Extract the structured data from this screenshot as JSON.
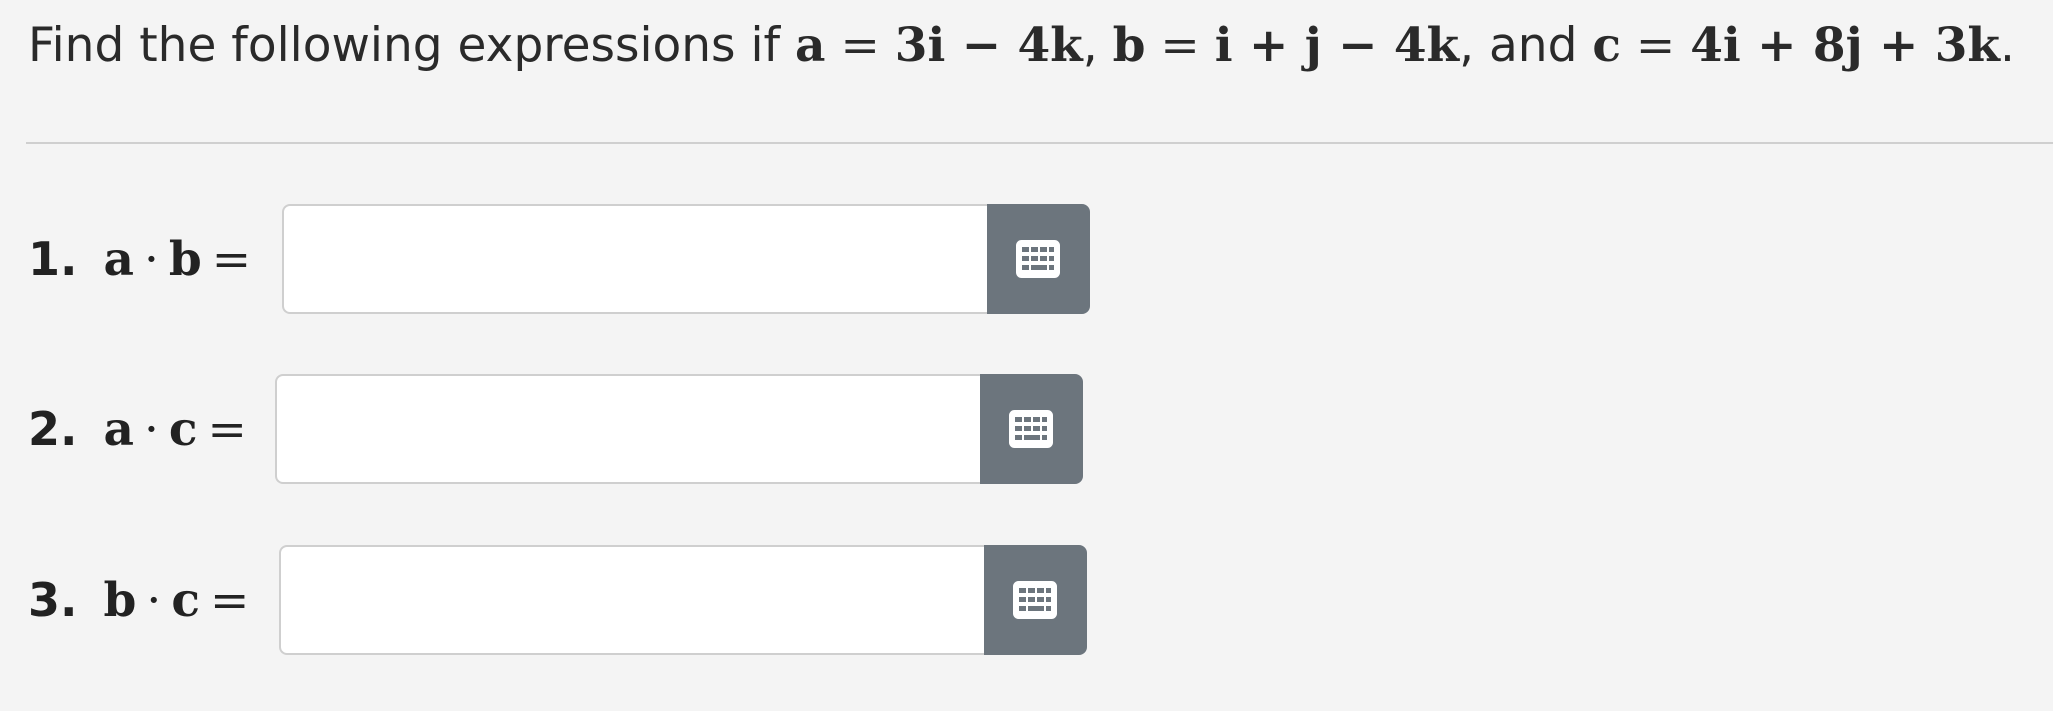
{
  "prompt": {
    "lead": "Find the following expressions if ",
    "a_name": "a",
    "eq": " = ",
    "a_value": "3i − 4k",
    "sep1": ", ",
    "b_name": "b",
    "b_value": "i + j − 4k",
    "sep2": ", and ",
    "c_name": "c",
    "c_value": "4i + 8j + 3k",
    "end": "."
  },
  "questions": [
    {
      "number": "1.",
      "left": "a",
      "op": "·",
      "right": "b",
      "equals": "=",
      "value": "",
      "placeholder": ""
    },
    {
      "number": "2.",
      "left": "a",
      "op": "·",
      "right": "c",
      "equals": "=",
      "value": "",
      "placeholder": ""
    },
    {
      "number": "3.",
      "left": "b",
      "op": "·",
      "right": "c",
      "equals": "=",
      "value": "",
      "placeholder": ""
    }
  ],
  "icons": {
    "keypad": "keypad-icon"
  },
  "colors": {
    "background": "#f4f4f4",
    "keypad_button": "#6c757d",
    "input_border": "#cfcfcf"
  }
}
